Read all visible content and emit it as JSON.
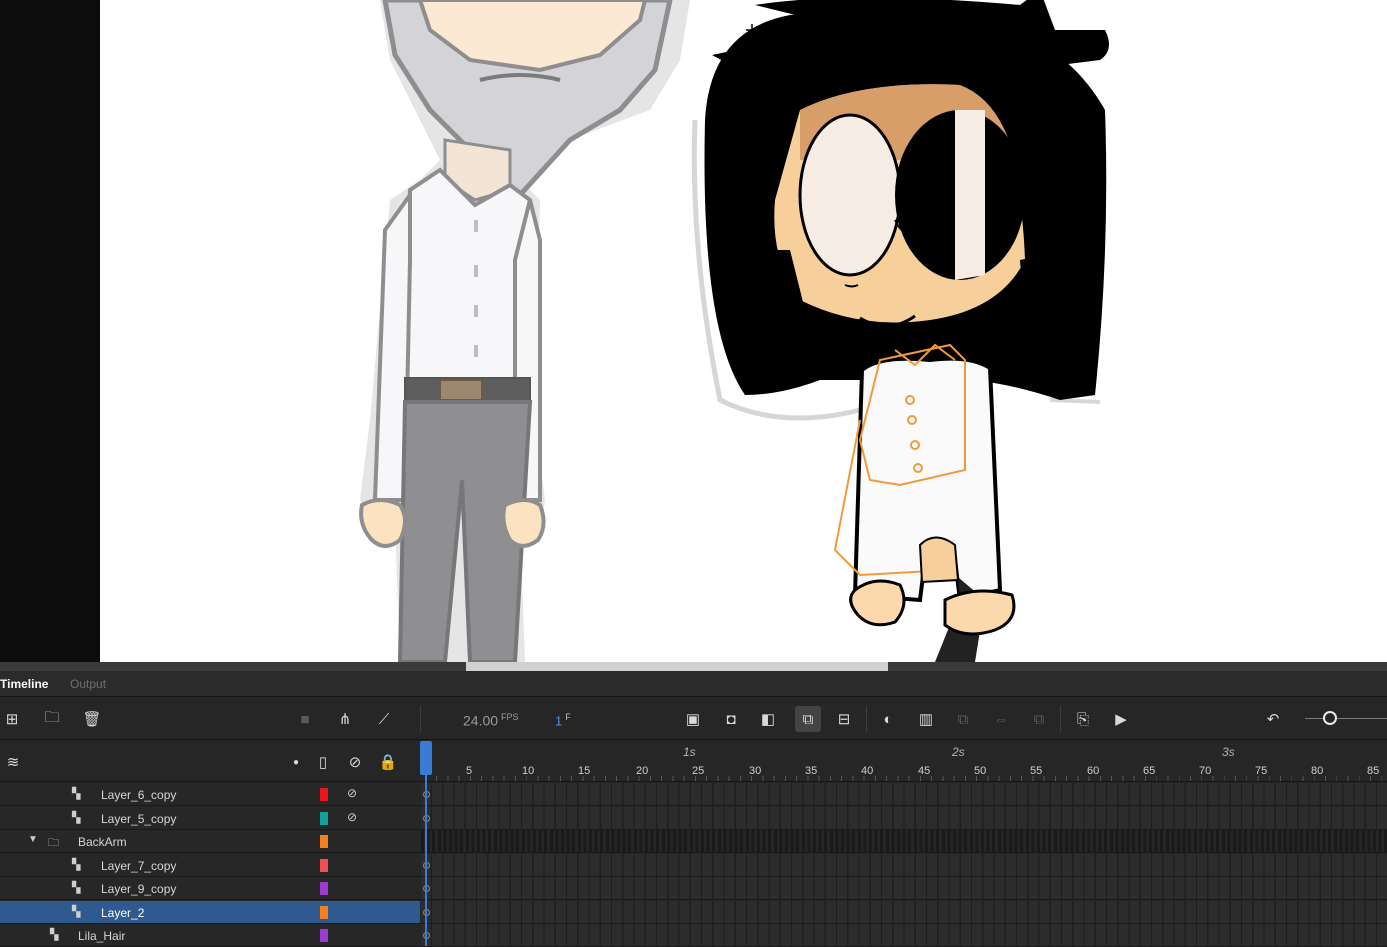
{
  "tabs": {
    "timeline": "Timeline",
    "output": "Output"
  },
  "toolbar": {
    "fps_value": "24.00",
    "fps_unit": "FPS",
    "frame_value": "1",
    "frame_unit": "F"
  },
  "ruler": {
    "seconds": [
      "1s",
      "2s",
      "3s"
    ],
    "ticks": [
      "5",
      "10",
      "15",
      "20",
      "25",
      "30",
      "35",
      "40",
      "45",
      "50",
      "55",
      "60",
      "65",
      "70",
      "75",
      "80",
      "85"
    ]
  },
  "layers": [
    {
      "name": "Layer_6_copy",
      "color": "#e8161d",
      "hidden": true,
      "type": "layer"
    },
    {
      "name": "Layer_5_copy",
      "color": "#12a39a",
      "hidden": true,
      "type": "layer"
    },
    {
      "name": "BackArm",
      "color": "#f5801f",
      "hidden": false,
      "type": "folder"
    },
    {
      "name": "Layer_7_copy",
      "color": "#f0504e",
      "hidden": false,
      "type": "layer"
    },
    {
      "name": "Layer_9_copy",
      "color": "#9b3bd1",
      "hidden": false,
      "type": "layer"
    },
    {
      "name": "Layer_2",
      "color": "#f5801f",
      "hidden": false,
      "type": "layer",
      "selected": true
    },
    {
      "name": "Lila_Hair",
      "color": "#9b3bd1",
      "hidden": false,
      "type": "layer"
    }
  ]
}
